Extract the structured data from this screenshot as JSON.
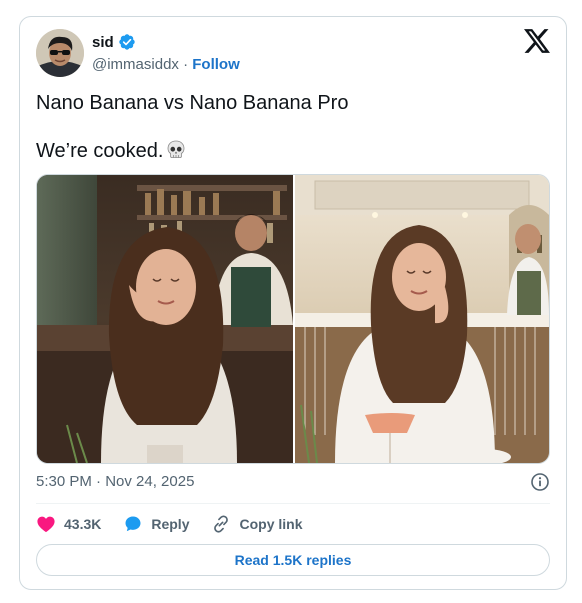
{
  "author": {
    "display_name": "sid",
    "handle": "@immasiddx",
    "separator": " · ",
    "follow_label": "Follow"
  },
  "tweet": {
    "line1": "Nano Banana vs Nano Banana Pro",
    "line2": "We’re cooked.",
    "emoji": "skull-icon"
  },
  "media": {
    "left_image": "Nano Banana render: woman at a bar with bartender",
    "right_image": "Nano Banana Pro render: woman at a bar with bartender"
  },
  "meta": {
    "timestamp": "5:30 PM · Nov 24, 2025"
  },
  "actions": {
    "like_count": "43.3K",
    "reply_label": "Reply",
    "copy_link_label": "Copy link"
  },
  "replies_button": "Read 1.5K replies",
  "colors": {
    "accent": "#1d74c9",
    "verified": "#1d9bf0",
    "like": "#f91880",
    "text": "#0f1419",
    "muted": "#536471",
    "border": "#cfd9de"
  }
}
